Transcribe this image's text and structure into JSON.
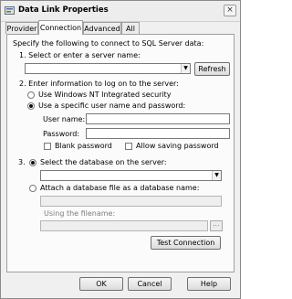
{
  "window": {
    "title": "Data Link Properties",
    "close_glyph": "×"
  },
  "tabs": [
    {
      "label": "Provider"
    },
    {
      "label": "Connection"
    },
    {
      "label": "Advanced"
    },
    {
      "label": "All"
    }
  ],
  "connection": {
    "intro": "Specify the following to connect to SQL Server data:",
    "step1_label": "1. Select or enter a server name:",
    "server_name_value": "",
    "refresh_button": "Refresh",
    "step2_label": "2. Enter information to log on to the server:",
    "logon_option_nt": "Use Windows NT Integrated security",
    "logon_option_specific": "Use a specific user name and password:",
    "selected_logon_option": "specific",
    "user_name_label": "User name:",
    "user_name_value": "",
    "password_label": "Password:",
    "password_value": "",
    "blank_password_label": "Blank password",
    "blank_password_checked": false,
    "allow_saving_password_label": "Allow saving password",
    "allow_saving_password_checked": false,
    "step3_number": "3.",
    "db_option_select": "Select the database on the server:",
    "database_value": "",
    "db_option_attach": "Attach a database file as a database name:",
    "selected_db_option": "select",
    "attach_name_value": "",
    "using_filename_label": "Using the filename:",
    "filename_value": "",
    "browse_button": "...",
    "test_connection_button": "Test Connection"
  },
  "footer": {
    "ok_button": "OK",
    "cancel_button": "Cancel",
    "help_button": "Help"
  }
}
